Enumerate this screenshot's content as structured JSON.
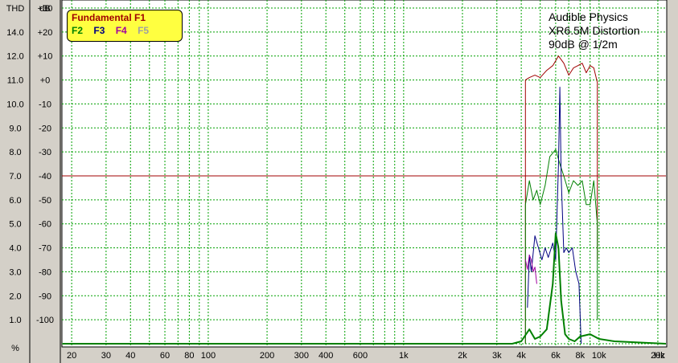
{
  "chart_data": {
    "type": "line",
    "title": "",
    "annotation": [
      "Audible Physics",
      "XR6.5M Distortion",
      "90dB @ 1/2m"
    ],
    "xlabel": "Hz",
    "x_scale": "log",
    "xlim": [
      18,
      22000
    ],
    "x_ticks": [
      "20",
      "30",
      "40",
      "60",
      "80",
      "100",
      "200",
      "300",
      "400",
      "600",
      "1k",
      "2k",
      "3k",
      "4k",
      "6k",
      "8k",
      "10k",
      "20k",
      "30k"
    ],
    "x_tick_values": [
      20,
      30,
      40,
      60,
      80,
      100,
      200,
      300,
      400,
      600,
      1000,
      2000,
      3000,
      4000,
      6000,
      8000,
      10000,
      20000,
      30000
    ],
    "left_axis": {
      "label": "THD",
      "unit": "%",
      "ticks": [
        "14.0",
        "12.0",
        "11.0",
        "10.0",
        "9.0",
        "8.0",
        "7.0",
        "6.0",
        "5.0",
        "4.0",
        "3.0",
        "2.0",
        "1.0"
      ]
    },
    "right_axis": {
      "label": "dB",
      "ylim": [
        -110,
        30
      ],
      "ticks": [
        "+30",
        "+20",
        "+10",
        "+0",
        "-10",
        "-20",
        "-30",
        "-40",
        "-50",
        "-60",
        "-70",
        "-80",
        "-90",
        "-100"
      ]
    },
    "reference_line": {
      "value": -40,
      "color": "#a00000"
    },
    "grid": true,
    "legend": {
      "placement": "top-left",
      "entries": [
        {
          "label": "Fundamental F1",
          "color": "#a00000"
        },
        {
          "label": "F2",
          "color": "#008000"
        },
        {
          "label": "F3",
          "color": "#000080"
        },
        {
          "label": "F4",
          "color": "#a000a0"
        },
        {
          "label": "F5",
          "color": "#a0a0a0"
        }
      ]
    },
    "series": [
      {
        "name": "Fundamental F1",
        "color": "#a00000",
        "width": 1,
        "x": [
          4200,
          4200,
          4400,
          4700,
          5000,
          5400,
          5800,
          6200,
          6600,
          7000,
          7400,
          7800,
          8200,
          8600,
          9000,
          9400,
          9800,
          9800
        ],
        "y": [
          -110,
          0,
          1,
          2,
          1,
          4,
          6,
          10,
          7,
          2,
          5,
          6,
          7,
          3,
          6,
          5,
          -1,
          -75
        ]
      },
      {
        "name": "F2",
        "color": "#008000",
        "width": 1,
        "x": [
          4200,
          4200,
          4400,
          4600,
          4800,
          5000,
          5300,
          5600,
          6000,
          6300,
          6600,
          7000,
          7400,
          7800,
          8200,
          8600,
          9000,
          9400,
          9800,
          9800
        ],
        "y": [
          -110,
          -52,
          -42,
          -50,
          -46,
          -52,
          -44,
          -32,
          -29,
          -35,
          -40,
          -47,
          -42,
          -44,
          -42,
          -52,
          -52,
          -42,
          -60,
          -100
        ]
      },
      {
        "name": "F3",
        "color": "#000080",
        "width": 1,
        "x": [
          4300,
          4400,
          4500,
          4700,
          4900,
          5100,
          5300,
          5500,
          5800,
          6000,
          6200,
          6300,
          6400,
          6600,
          6800,
          7000,
          7300,
          7600,
          7900,
          8100
        ],
        "y": [
          -95,
          -73,
          -80,
          -65,
          -70,
          -75,
          -70,
          -74,
          -68,
          -75,
          -35,
          -3,
          -40,
          -72,
          -70,
          -72,
          -70,
          -80,
          -85,
          -110
        ]
      },
      {
        "name": "F4",
        "color": "#a000a0",
        "width": 1,
        "x": [
          4200,
          4300,
          4400,
          4500,
          4600,
          4700,
          4800
        ],
        "y": [
          -75,
          -79,
          -73,
          -75,
          -80,
          -78,
          -85
        ]
      },
      {
        "name": "F2 (level)",
        "color": "#008000",
        "width": 2,
        "x": [
          18,
          3600,
          4000,
          4400,
          4700,
          5000,
          5400,
          5800,
          6000,
          6200,
          6400,
          6700,
          7000,
          7500,
          8000,
          9000,
          10000,
          12000,
          22000
        ],
        "y": [
          -110,
          -110,
          -109,
          -104,
          -108,
          -107,
          -104,
          -85,
          -64,
          -70,
          -92,
          -106,
          -108,
          -109,
          -107,
          -106,
          -108,
          -109,
          -110
        ]
      }
    ]
  }
}
